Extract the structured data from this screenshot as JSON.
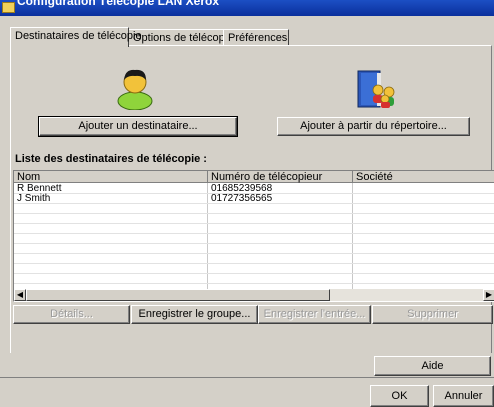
{
  "window": {
    "title": "Configuration Télécopie LAN Xerox"
  },
  "tabs": [
    {
      "label": "Destinataires de télécopie",
      "active": true
    },
    {
      "label": "Options de télécopie",
      "active": false
    },
    {
      "label": "Préférences",
      "active": false
    }
  ],
  "buttons": {
    "add_recipient": "Ajouter un destinataire...",
    "add_from_directory": "Ajouter à partir du répertoire...",
    "details": "Détails...",
    "save_group": "Enregistrer le groupe...",
    "save_entry": "Enregistrer l'entrée...",
    "delete": "Supprimer",
    "help": "Aide",
    "ok": "OK",
    "cancel": "Annuler"
  },
  "list": {
    "title": "Liste des destinataires de télécopie :",
    "columns": [
      "Nom",
      "Numéro de télécopieur",
      "Société"
    ],
    "rows": [
      {
        "name": "R Bennett",
        "number": "01685239568",
        "company": ""
      },
      {
        "name": "J Smith",
        "number": "01727356565",
        "company": ""
      }
    ]
  }
}
